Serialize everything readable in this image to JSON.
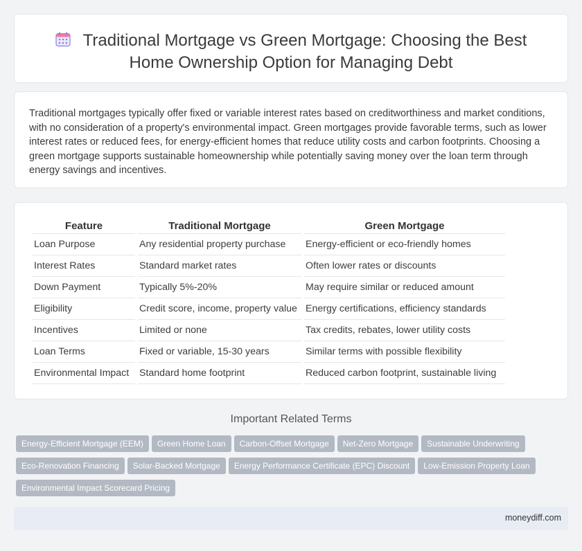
{
  "header": {
    "icon": "calendar-icon",
    "title_line1": "Traditional Mortgage vs Green Mortgage: Choosing the Best",
    "title_line2": "Home Ownership Option for Managing Debt"
  },
  "intro": {
    "text": "Traditional mortgages typically offer fixed or variable interest rates based on creditworthiness and market conditions, with no consideration of a property's environmental impact. Green mortgages provide favorable terms, such as lower interest rates or reduced fees, for energy-efficient homes that reduce utility costs and carbon footprints. Choosing a green mortgage supports sustainable homeownership while potentially saving money over the loan term through energy savings and incentives."
  },
  "table": {
    "headers": [
      "Feature",
      "Traditional Mortgage",
      "Green Mortgage"
    ],
    "rows": [
      [
        "Loan Purpose",
        "Any residential property purchase",
        "Energy-efficient or eco-friendly homes"
      ],
      [
        "Interest Rates",
        "Standard market rates",
        "Often lower rates or discounts"
      ],
      [
        "Down Payment",
        "Typically 5%-20%",
        "May require similar or reduced amount"
      ],
      [
        "Eligibility",
        "Credit score, income, property value",
        "Energy certifications, efficiency standards"
      ],
      [
        "Incentives",
        "Limited or none",
        "Tax credits, rebates, lower utility costs"
      ],
      [
        "Loan Terms",
        "Fixed or variable, 15-30 years",
        "Similar terms with possible flexibility"
      ],
      [
        "Environmental Impact",
        "Standard home footprint",
        "Reduced carbon footprint, sustainable living"
      ]
    ]
  },
  "related": {
    "heading": "Important Related Terms",
    "terms": [
      "Energy-Efficient Mortgage (EEM)",
      "Green Home Loan",
      "Carbon-Offset Mortgage",
      "Net-Zero Mortgage",
      "Sustainable Underwriting",
      "Eco-Renovation Financing",
      "Solar-Backed Mortgage",
      "Energy Performance Certificate (EPC) Discount",
      "Low-Emission Property Loan",
      "Environmental Impact Scorecard Pricing"
    ]
  },
  "footer": {
    "site": "moneydiff.com"
  },
  "colors": {
    "icon_accent": "#7b6fd6",
    "tag_bg": "#b3b9c3",
    "footer_bg": "#e8ecf4"
  }
}
